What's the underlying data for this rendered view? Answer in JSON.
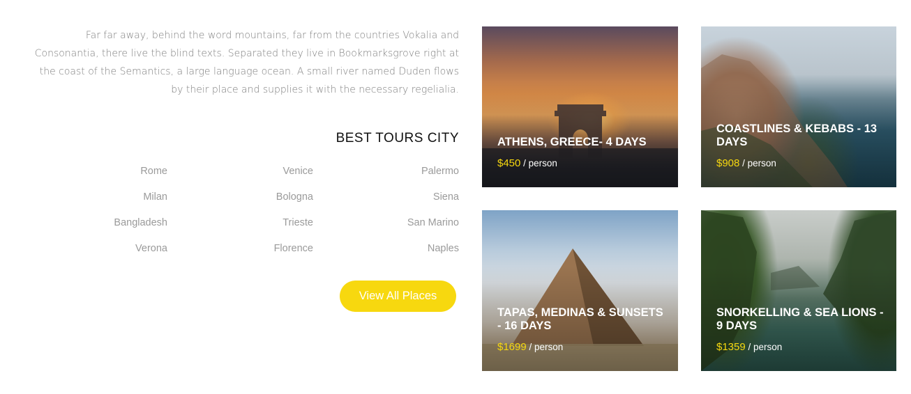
{
  "intro": "Far far away, behind the word mountains, far from the countries Vokalia and Consonantia, there live the blind texts. Separated they live in Bookmarksgrove right at the coast of the Semantics, a large language ocean. A small river named Duden flows by their place and supplies it with the necessary regelialia.",
  "best_tours": {
    "title": "BEST TOURS CITY",
    "cities": [
      "Rome",
      "Venice",
      "Palermo",
      "Milan",
      "Bologna",
      "Siena",
      "Bangladesh",
      "Trieste",
      "San Marino",
      "Verona",
      "Florence",
      "Naples"
    ],
    "button_label": "View All Places"
  },
  "tours": [
    {
      "name": "ATHENS, GREECE- 4 DAYS",
      "price": "$450",
      "unit": " / person"
    },
    {
      "name": "COASTLINES & KEBABS - 13 DAYS",
      "price": "$908",
      "unit": " / person"
    },
    {
      "name": "TAPAS, MEDINAS & SUNSETS - 16 DAYS",
      "price": "$1699",
      "unit": " / person"
    },
    {
      "name": "SNORKELLING & SEA LIONS - 9 DAYS",
      "price": "$1359",
      "unit": " / person"
    }
  ],
  "colors": {
    "accent": "#f7d80f",
    "title": "#111111",
    "muted": "#9a9a9a"
  }
}
